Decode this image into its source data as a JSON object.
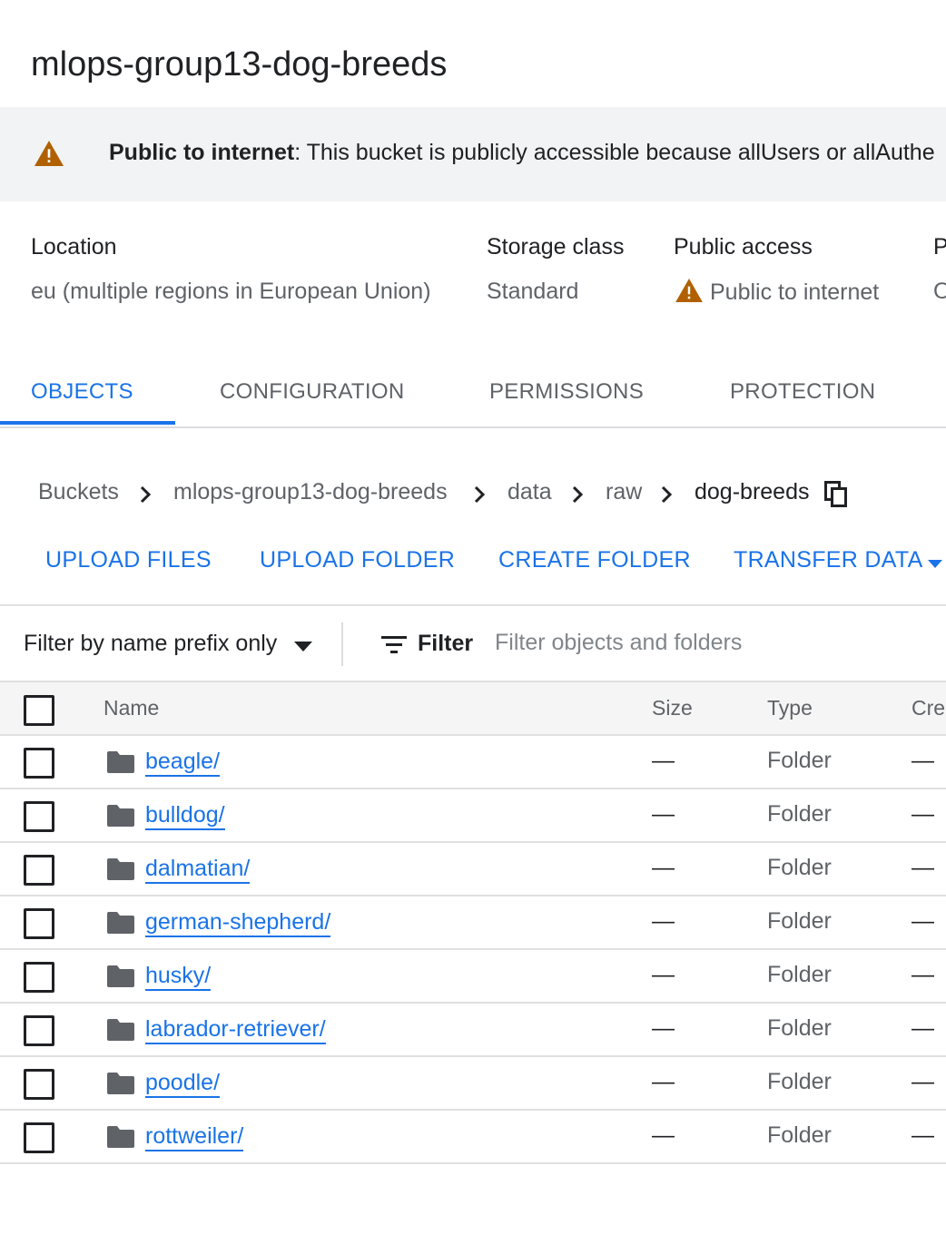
{
  "bucket": {
    "title": "mlops-group13-dog-breeds"
  },
  "banner": {
    "bold": "Public to internet",
    "text": ": This bucket is publicly accessible because allUsers or allAuthe",
    "icon": "warning-icon",
    "icon_color": "#b06000"
  },
  "meta": {
    "location": {
      "label": "Location",
      "value": "eu (multiple regions in European Union)"
    },
    "storage_class": {
      "label": "Storage class",
      "value": "Standard"
    },
    "public_access": {
      "label": "Public access",
      "value": "Public to internet"
    },
    "protection": {
      "label": "P",
      "value": "O"
    }
  },
  "tabs": [
    {
      "label": "OBJECTS",
      "active": true
    },
    {
      "label": "CONFIGURATION",
      "active": false
    },
    {
      "label": "PERMISSIONS",
      "active": false
    },
    {
      "label": "PROTECTION",
      "active": false
    }
  ],
  "breadcrumb": [
    "Buckets",
    "mlops-group13-dog-breeds",
    "data",
    "raw",
    "dog-breeds"
  ],
  "actions": {
    "upload_files": "UPLOAD FILES",
    "upload_folder": "UPLOAD FOLDER",
    "create_folder": "CREATE FOLDER",
    "transfer_data": "TRANSFER DATA"
  },
  "filter": {
    "mode": "Filter by name prefix only",
    "label": "Filter",
    "placeholder": "Filter objects and folders"
  },
  "table": {
    "columns": {
      "name": "Name",
      "size": "Size",
      "type": "Type",
      "created": "Cre"
    },
    "rows": [
      {
        "name": "beagle/",
        "size": "—",
        "type": "Folder",
        "created": "—"
      },
      {
        "name": "bulldog/",
        "size": "—",
        "type": "Folder",
        "created": "—"
      },
      {
        "name": "dalmatian/",
        "size": "—",
        "type": "Folder",
        "created": "—"
      },
      {
        "name": "german-shepherd/",
        "size": "—",
        "type": "Folder",
        "created": "—"
      },
      {
        "name": "husky/",
        "size": "—",
        "type": "Folder",
        "created": "—"
      },
      {
        "name": "labrador-retriever/",
        "size": "—",
        "type": "Folder",
        "created": "—"
      },
      {
        "name": "poodle/",
        "size": "—",
        "type": "Folder",
        "created": "—"
      },
      {
        "name": "rottweiler/",
        "size": "—",
        "type": "Folder",
        "created": "—"
      }
    ]
  },
  "colors": {
    "accent": "#1a73e8",
    "warning": "#b06000",
    "text_secondary": "#5f6368"
  }
}
